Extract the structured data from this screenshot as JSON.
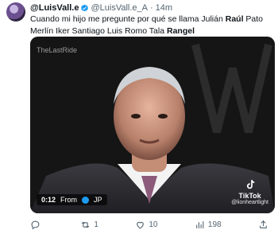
{
  "tweet": {
    "display_name": "@LuisVall.e",
    "handle": "@LuisVall.e_A",
    "separator": "·",
    "time": "14m",
    "text_parts": {
      "p1": "Cuando mi hijo me pregunte por qué se llama Julián ",
      "p2": "Raúl",
      "p3": " Pato Merlín Iker Santiago Luis Romo Tala ",
      "p4": "Rangel"
    }
  },
  "video": {
    "watermark": "TheLastRide",
    "time": "0:12",
    "from_label": "From",
    "from_source": "JP",
    "tiktok_brand": "TikTok",
    "tiktok_user": "@lionheartlight"
  },
  "actions": {
    "reply_count": "",
    "retweet_count": "1",
    "like_count": "10",
    "views_count": "198"
  },
  "colors": {
    "text": "#0f1419",
    "muted": "#536471",
    "verified": "#1d9bf0"
  }
}
